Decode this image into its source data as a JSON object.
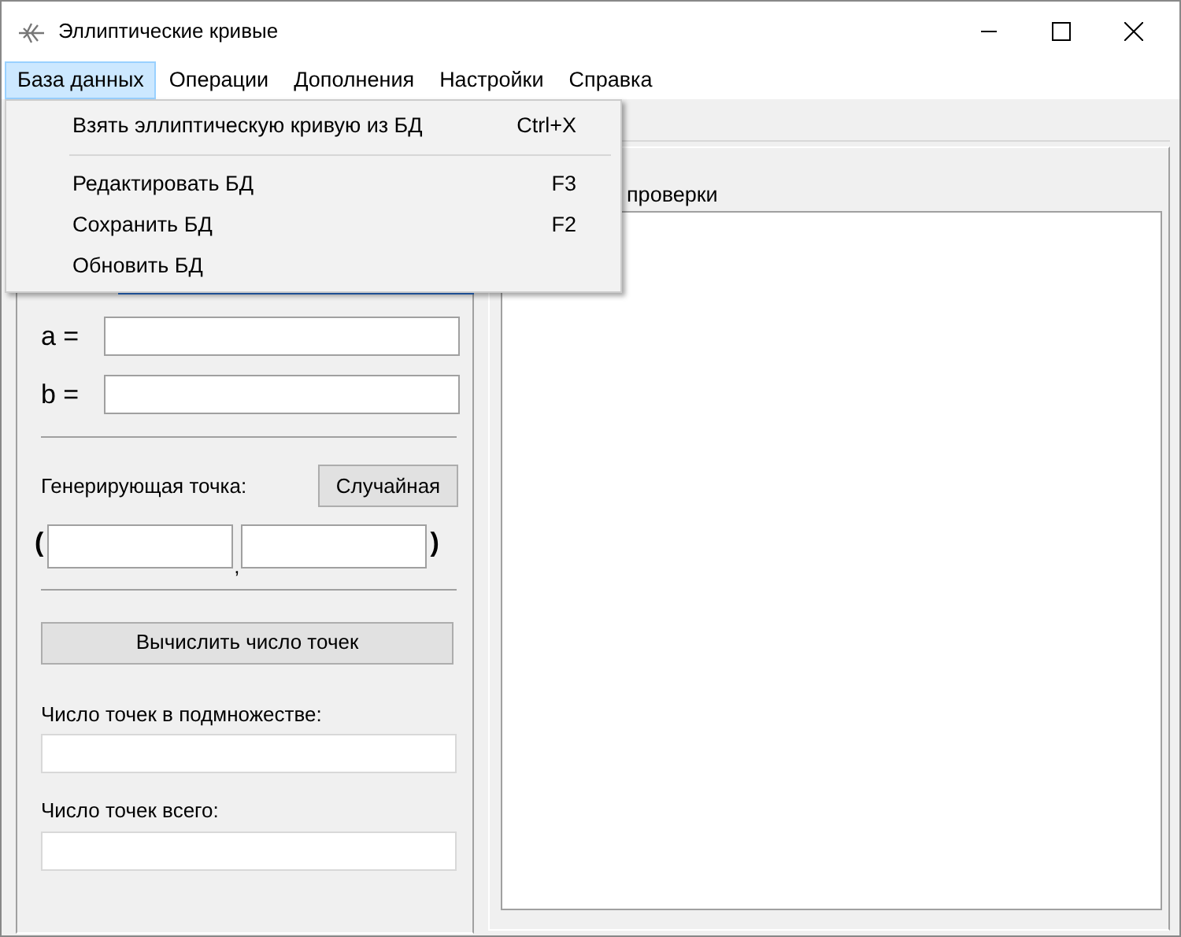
{
  "window": {
    "title": "Эллиптические кривые"
  },
  "menu_bar": [
    {
      "label": "База данных",
      "selected": true
    },
    {
      "label": "Операции",
      "selected": false
    },
    {
      "label": "Дополнения",
      "selected": false
    },
    {
      "label": "Настройки",
      "selected": false
    },
    {
      "label": "Справка",
      "selected": false
    }
  ],
  "dropdown": [
    {
      "kind": "item",
      "label": "Взять эллиптическую кривую из БД",
      "shortcut": "Ctrl+X"
    },
    {
      "kind": "separator"
    },
    {
      "kind": "item",
      "label": "Редактировать БД",
      "shortcut": "F3"
    },
    {
      "kind": "item",
      "label": "Сохранить БД",
      "shortcut": "F2"
    },
    {
      "kind": "item",
      "label": "Обновить БД"
    }
  ],
  "left_panel": {
    "a_label": "a =",
    "b_label": "b =",
    "generating_point_label": "Генерирующая точка:",
    "random_button": "Случайная",
    "open_paren": "(",
    "comma": ",",
    "close_paren": ")",
    "compute_button": "Вычислить число точек",
    "subset_count_label": "Число точек в подмножестве:",
    "total_count_label": "Число точек всего:"
  },
  "right_panel": {
    "title": "проверки"
  }
}
